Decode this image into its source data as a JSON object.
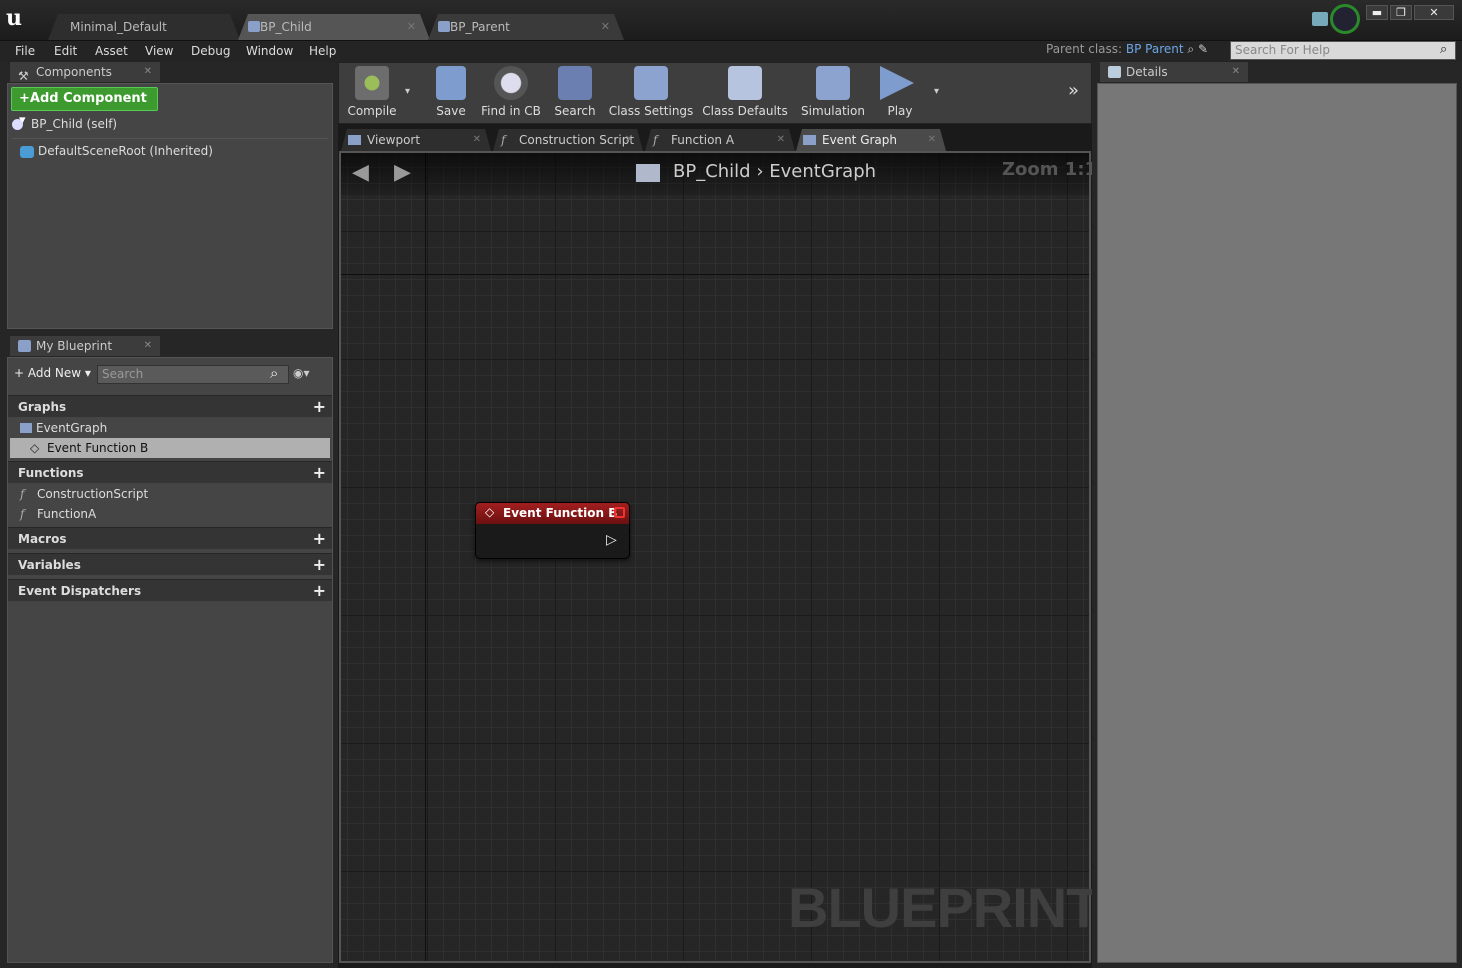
{
  "app": {
    "tabs": [
      {
        "label": "Minimal_Default"
      },
      {
        "label": "BP_Child"
      },
      {
        "label": "BP_Parent"
      }
    ],
    "window_controls": [
      "▬",
      "❐",
      "✕"
    ]
  },
  "menu": [
    "File",
    "Edit",
    "Asset",
    "View",
    "Debug",
    "Window",
    "Help"
  ],
  "parent_class": {
    "label": "Parent class:",
    "value": "BP Parent"
  },
  "help_search": {
    "placeholder": "Search For Help"
  },
  "components": {
    "tab": "Components",
    "add_button": "+Add Component",
    "items": [
      "BP_Child (self)",
      "DefaultSceneRoot (Inherited)"
    ]
  },
  "my_blueprint": {
    "tab": "My Blueprint",
    "add_new": "+ Add New",
    "search_placeholder": "Search",
    "sections": {
      "graphs": "Graphs",
      "functions": "Functions",
      "macros": "Macros",
      "variables": "Variables",
      "dispatchers": "Event Dispatchers"
    },
    "graphs": [
      "EventGraph",
      "Event Function B"
    ],
    "functions": [
      "ConstructionScript",
      "FunctionA"
    ]
  },
  "toolbar": [
    "Compile",
    "Save",
    "Find in CB",
    "Search",
    "Class Settings",
    "Class Defaults",
    "Simulation",
    "Play"
  ],
  "editor_tabs": [
    "Viewport",
    "Construction Script",
    "Function A",
    "Event Graph"
  ],
  "graph": {
    "breadcrumb": [
      "BP_Child",
      "EventGraph"
    ],
    "zoom": "Zoom 1:1",
    "watermark": "BLUEPRINT",
    "node_title": "Event Function B"
  },
  "details": {
    "tab": "Details"
  },
  "colors": {
    "add_component": "#3d9a2e",
    "node_header": "#8c1a1a",
    "link": "#6da6e6"
  }
}
